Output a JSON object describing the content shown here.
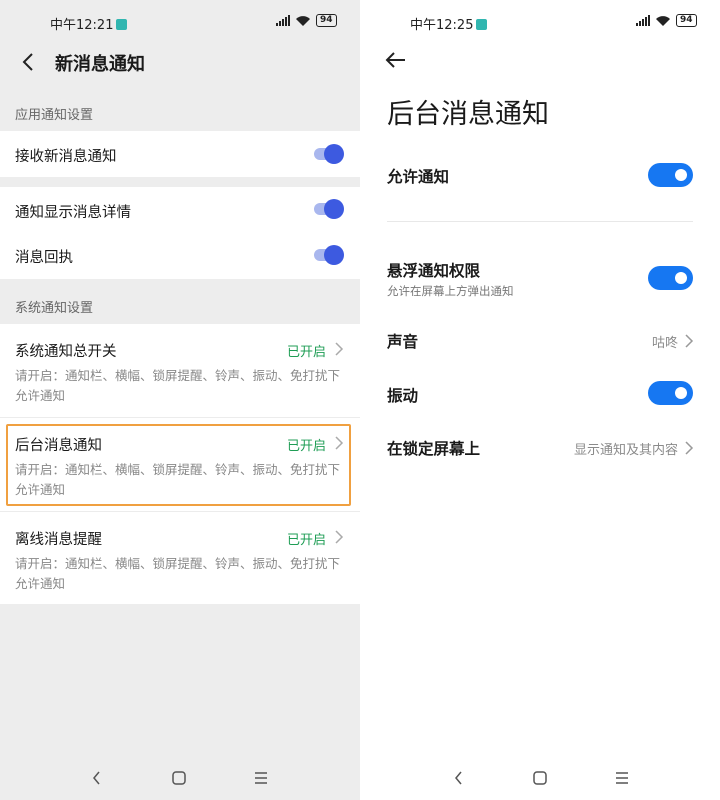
{
  "left": {
    "status": {
      "time": "中午12:21",
      "battery": "94"
    },
    "header": {
      "title": "新消息通知"
    },
    "app_section": {
      "label": "应用通知设置",
      "receive": {
        "label": "接收新消息通知",
        "on": true
      },
      "show_detail": {
        "label": "通知显示消息详情",
        "on": true
      },
      "receipt": {
        "label": "消息回执",
        "on": true
      }
    },
    "system_section": {
      "label": "系统通知设置",
      "items": [
        {
          "title": "系统通知总开关",
          "status": "已开启",
          "desc": "请开启：通知栏、横幅、锁屏提醒、铃声、振动、免打扰下允许通知"
        },
        {
          "title": "后台消息通知",
          "status": "已开启",
          "desc": "请开启：通知栏、横幅、锁屏提醒、铃声、振动、免打扰下允许通知"
        },
        {
          "title": "离线消息提醒",
          "status": "已开启",
          "desc": "请开启：通知栏、横幅、锁屏提醒、铃声、振动、免打扰下允许通知"
        }
      ]
    }
  },
  "right": {
    "status": {
      "time": "中午12:25",
      "battery": "94"
    },
    "title": "后台消息通知",
    "allow": {
      "label": "允许通知",
      "on": true
    },
    "floating": {
      "label": "悬浮通知权限",
      "sub": "允许在屏幕上方弹出通知",
      "on": true
    },
    "sound": {
      "label": "声音",
      "value": "咕咚"
    },
    "vibrate": {
      "label": "振动",
      "on": true
    },
    "lockscreen": {
      "label": "在锁定屏幕上",
      "value": "显示通知及其内容"
    }
  },
  "colors": {
    "toggle_left": "#3d5ae0",
    "toggle_right": "#1677f2",
    "status_green": "#1f9d55",
    "highlight": "#f0a040"
  },
  "icons": [
    "back-chevron-icon",
    "back-arrow-icon",
    "chevron-right-icon",
    "signal-icon",
    "wifi-icon",
    "battery-icon",
    "nav-back-icon",
    "nav-home-icon",
    "nav-menu-icon"
  ]
}
